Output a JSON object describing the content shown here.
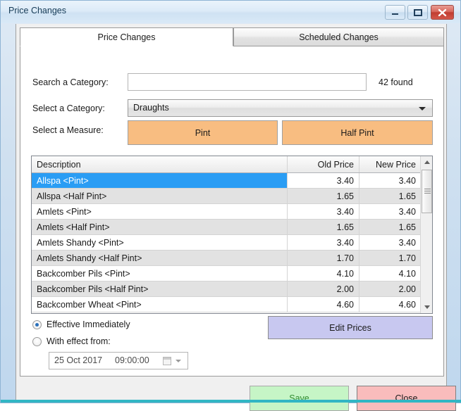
{
  "window": {
    "title": "Price Changes",
    "controls": {
      "minimize": "minimize-icon",
      "maximize": "maximize-icon",
      "close": "close-icon"
    }
  },
  "tabs": [
    {
      "label": "Price Changes",
      "active": true
    },
    {
      "label": "Scheduled Changes",
      "active": false
    }
  ],
  "form": {
    "search_label": "Search a Category:",
    "search_value": "",
    "search_placeholder": "",
    "found_label": "42 found",
    "category_label": "Select a Category:",
    "category_value": "Draughts",
    "measure_label": "Select a Measure:",
    "measure_buttons": [
      {
        "label": "Pint"
      },
      {
        "label": "Half Pint"
      }
    ]
  },
  "grid": {
    "columns": [
      "Description",
      "Old Price",
      "New Price"
    ],
    "rows": [
      {
        "description": "Allspa <Pint>",
        "old_price": "3.40",
        "new_price": "3.40",
        "selected": true
      },
      {
        "description": "Allspa <Half Pint>",
        "old_price": "1.65",
        "new_price": "1.65",
        "selected": false
      },
      {
        "description": "Amlets <Pint>",
        "old_price": "3.40",
        "new_price": "3.40",
        "selected": false
      },
      {
        "description": "Amlets <Half Pint>",
        "old_price": "1.65",
        "new_price": "1.65",
        "selected": false
      },
      {
        "description": "Amlets Shandy <Pint>",
        "old_price": "3.40",
        "new_price": "3.40",
        "selected": false
      },
      {
        "description": "Amlets Shandy <Half Pint>",
        "old_price": "1.70",
        "new_price": "1.70",
        "selected": false
      },
      {
        "description": "Backcomber Pils <Pint>",
        "old_price": "4.10",
        "new_price": "4.10",
        "selected": false
      },
      {
        "description": "Backcomber Pils <Half Pint>",
        "old_price": "2.00",
        "new_price": "2.00",
        "selected": false
      },
      {
        "description": "Backcomber Wheat <Pint>",
        "old_price": "4.60",
        "new_price": "4.60",
        "selected": false
      }
    ]
  },
  "effective": {
    "immediate_label": "Effective Immediately",
    "immediate_selected": true,
    "with_effect_label": "With effect from:",
    "with_effect_selected": false,
    "date_value": "25 Oct 2017",
    "time_value": "09:00:00"
  },
  "actions": {
    "edit_prices_label": "Edit Prices",
    "save_label": "Save",
    "close_label": "Close"
  },
  "colors": {
    "accent_selection": "#2a9df4",
    "measure_button": "#f8bd81",
    "edit_prices_button": "#c8c8f0",
    "save_button": "#c6f5c6",
    "save_text": "#2e8b2e",
    "close_button": "#f9bcbc",
    "window_close": "#c03d31",
    "bottom_accent": "#31b6c4"
  }
}
